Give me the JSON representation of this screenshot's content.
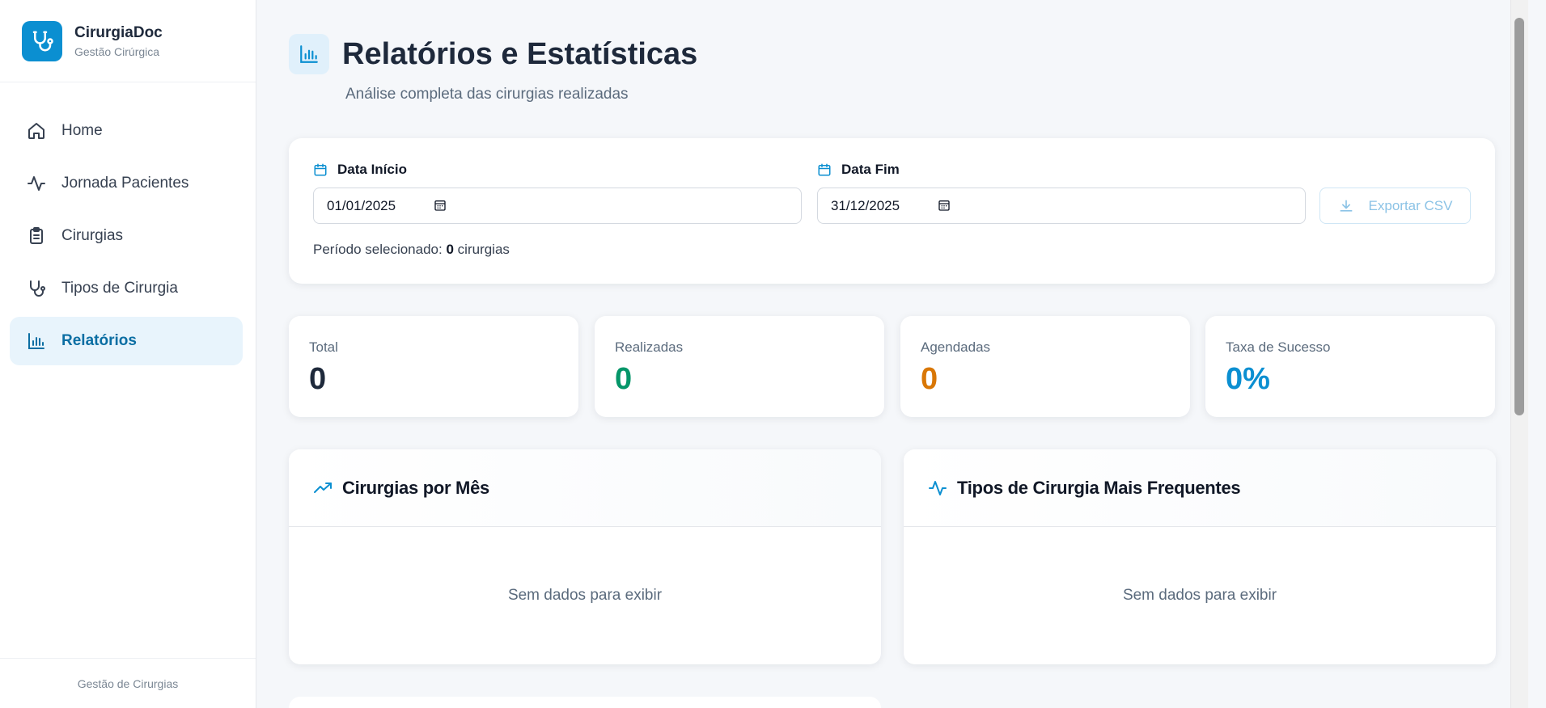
{
  "brand": {
    "name": "CirurgiaDoc",
    "subtitle": "Gestão Cirúrgica"
  },
  "sidebar": {
    "items": [
      {
        "label": "Home",
        "icon": "home-icon",
        "active": false
      },
      {
        "label": "Jornada Pacientes",
        "icon": "activity-icon",
        "active": false
      },
      {
        "label": "Cirurgias",
        "icon": "clipboard-icon",
        "active": false
      },
      {
        "label": "Tipos de Cirurgia",
        "icon": "stethoscope-icon",
        "active": false
      },
      {
        "label": "Relatórios",
        "icon": "bar-chart-icon",
        "active": true
      }
    ],
    "footer": "Gestão de Cirurgias"
  },
  "header": {
    "title": "Relatórios e Estatísticas",
    "subtitle": "Análise completa das cirurgias realizadas"
  },
  "filters": {
    "start_label": "Data Início",
    "start_value": "01/01/2025",
    "end_label": "Data Fim",
    "end_value": "31/12/2025",
    "export_label": "Exportar CSV",
    "period_prefix": "Período selecionado:",
    "period_count": "0",
    "period_suffix": "cirurgias"
  },
  "stats": [
    {
      "label": "Total",
      "value": "0",
      "color": "#1e293b"
    },
    {
      "label": "Realizadas",
      "value": "0",
      "color": "#059669"
    },
    {
      "label": "Agendadas",
      "value": "0",
      "color": "#d97706"
    },
    {
      "label": "Taxa de Sucesso",
      "value": "0%",
      "color": "#0b8fd1"
    }
  ],
  "charts": [
    {
      "title": "Cirurgias por Mês",
      "icon": "trending-up-icon",
      "empty": "Sem dados para exibir"
    },
    {
      "title": "Tipos de Cirurgia Mais Frequentes",
      "icon": "activity-icon",
      "empty": "Sem dados para exibir"
    }
  ],
  "colors": {
    "accent": "#0b8fd1",
    "active_bg": "#e8f4fc",
    "success": "#059669",
    "warning": "#d97706"
  }
}
